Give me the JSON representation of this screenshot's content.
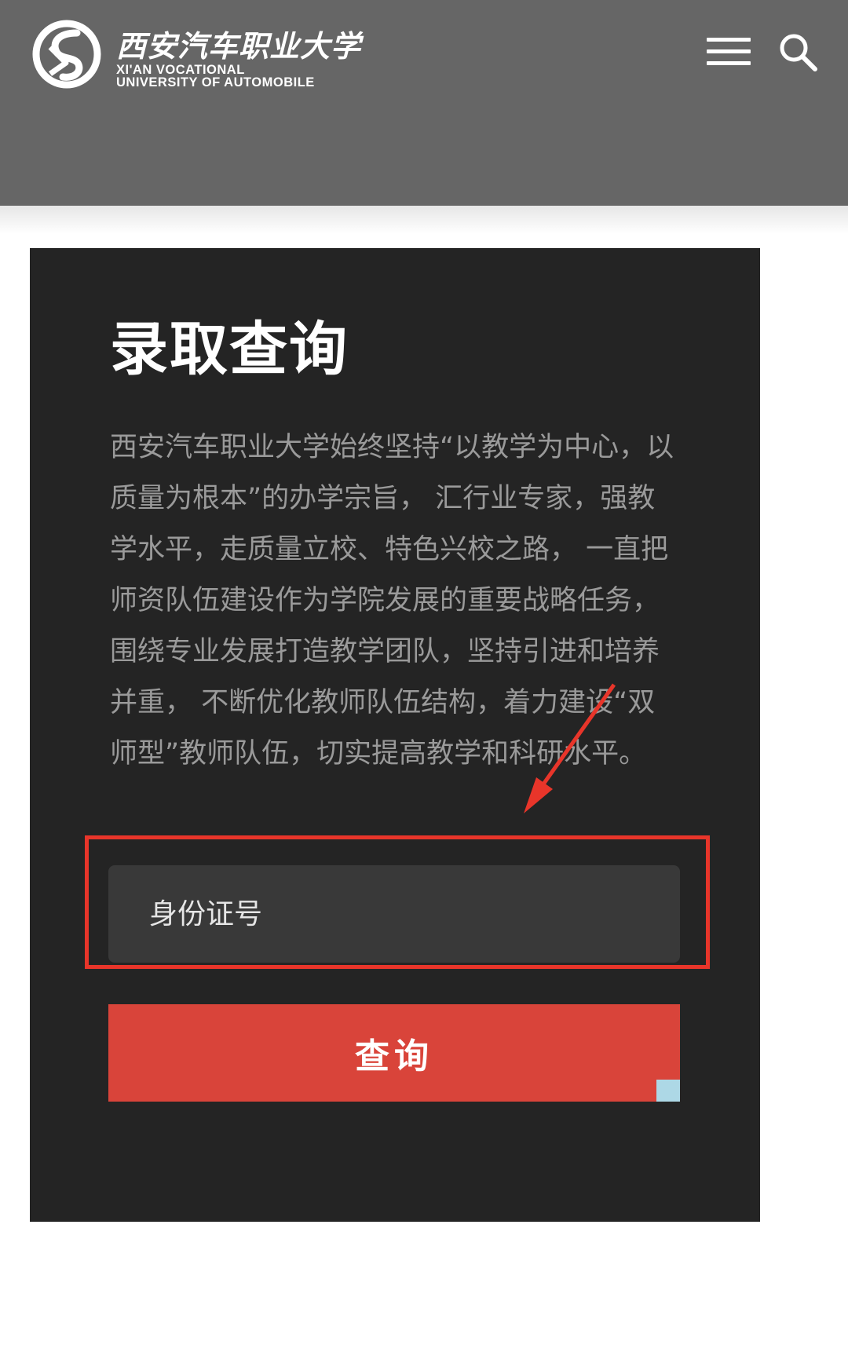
{
  "header": {
    "logo_cn": "西安汽车职业大学",
    "logo_en_line1": "XI'AN VOCATIONAL",
    "logo_en_line2": "UNIVERSITY OF AUTOMOBILE",
    "background_color": "#666666"
  },
  "card": {
    "title": "录取查询",
    "description": "西安汽车职业大学始终坚持“以教学为中心，以质量为根本”的办学宗旨， 汇行业专家，强教学水平，走质量立校、特色兴校之路， 一直把师资队伍建设作为学院发展的重要战略任务，围绕专业发展打造教学团队，坚持引进和培养并重， 不断优化教师队伍结构，着力建设“双师型”教师队伍，切实提高教学和科研水平。",
    "id_input_placeholder": "身份证号",
    "query_button_label": "查询",
    "background_color": "#242424",
    "button_color": "#d9443a",
    "annotation_color": "#e8352a"
  },
  "icons": {
    "menu": "hamburger-menu-icon",
    "search": "search-icon",
    "logo": "university-logo-icon"
  }
}
